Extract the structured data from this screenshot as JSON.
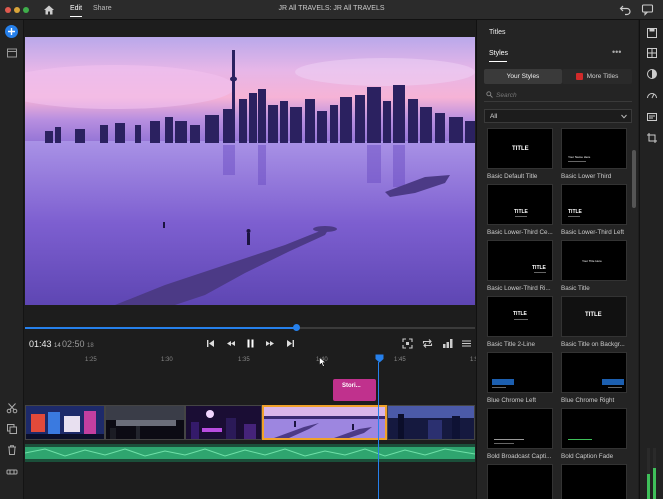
{
  "window": {
    "title": "JR All TRAVELS: JR All TRAVELS",
    "menu_tabs": [
      "Edit",
      "Share"
    ],
    "active_tab": "Edit"
  },
  "left_toolbar": {
    "icons": [
      "add-media-icon",
      "project-assets-icon",
      "scissors-icon",
      "copy-icon",
      "trash-icon",
      "timeline-settings-icon"
    ]
  },
  "player": {
    "current_time": "01:43",
    "current_frames": "14",
    "duration": "02:50",
    "duration_frames": "18",
    "scrub_progress": 0.6,
    "controls": [
      "go-to-start-icon",
      "step-back-icon",
      "pause-icon",
      "step-forward-icon",
      "go-to-end-icon"
    ],
    "right_controls": [
      "fit-icon",
      "loop-icon",
      "resolution-icon",
      "settings-icon"
    ]
  },
  "timeline": {
    "ruler_labels": [
      "1:25",
      "1:30",
      "1:35",
      "1:40",
      "1:45",
      "1:50"
    ],
    "title_clip_label": "Stori...",
    "playhead_time": "1:43",
    "clip_count": 5,
    "selected_clip_index": 3
  },
  "titles_panel": {
    "heading": "Titles",
    "tab": "Styles",
    "more_label": "•••",
    "segment_left": "Your Styles",
    "segment_right": "More Titles",
    "search_placeholder": "Search",
    "filter_value": "All",
    "cards": [
      {
        "label": "Basic Default Title",
        "thumb_text": "TITLE"
      },
      {
        "label": "Basic Lower Third",
        "thumb_text": "Your Name Here"
      },
      {
        "label": "Basic Lower-Third Ce...",
        "thumb_text": "TITLE"
      },
      {
        "label": "Basic Lower-Third Left",
        "thumb_text": "TITLE"
      },
      {
        "label": "Basic Lower-Third Ri...",
        "thumb_text": "TITLE"
      },
      {
        "label": "Basic Title",
        "thumb_text": "Your Title Here"
      },
      {
        "label": "Basic Title 2-Line",
        "thumb_text": "TITLE"
      },
      {
        "label": "Basic Title on Backgr...",
        "thumb_text": "TITLE"
      },
      {
        "label": "Blue Chrome Left",
        "thumb_text": ""
      },
      {
        "label": "Blue Chrome Right",
        "thumb_text": ""
      },
      {
        "label": "Bold Broadcast Capti...",
        "thumb_text": ""
      },
      {
        "label": "Bold Caption Fade",
        "thumb_text": ""
      }
    ]
  },
  "right_strip": {
    "icons": [
      "save-icon",
      "export-icon",
      "color-icon",
      "speed-icon",
      "captions-icon",
      "crop-icon",
      "comment-icon",
      "back-icon"
    ]
  },
  "colors": {
    "accent": "#2680eb",
    "title_clip": "#c0318d",
    "selected_clip_border": "#f0a12a",
    "audio_track": "#1b4f3a"
  }
}
